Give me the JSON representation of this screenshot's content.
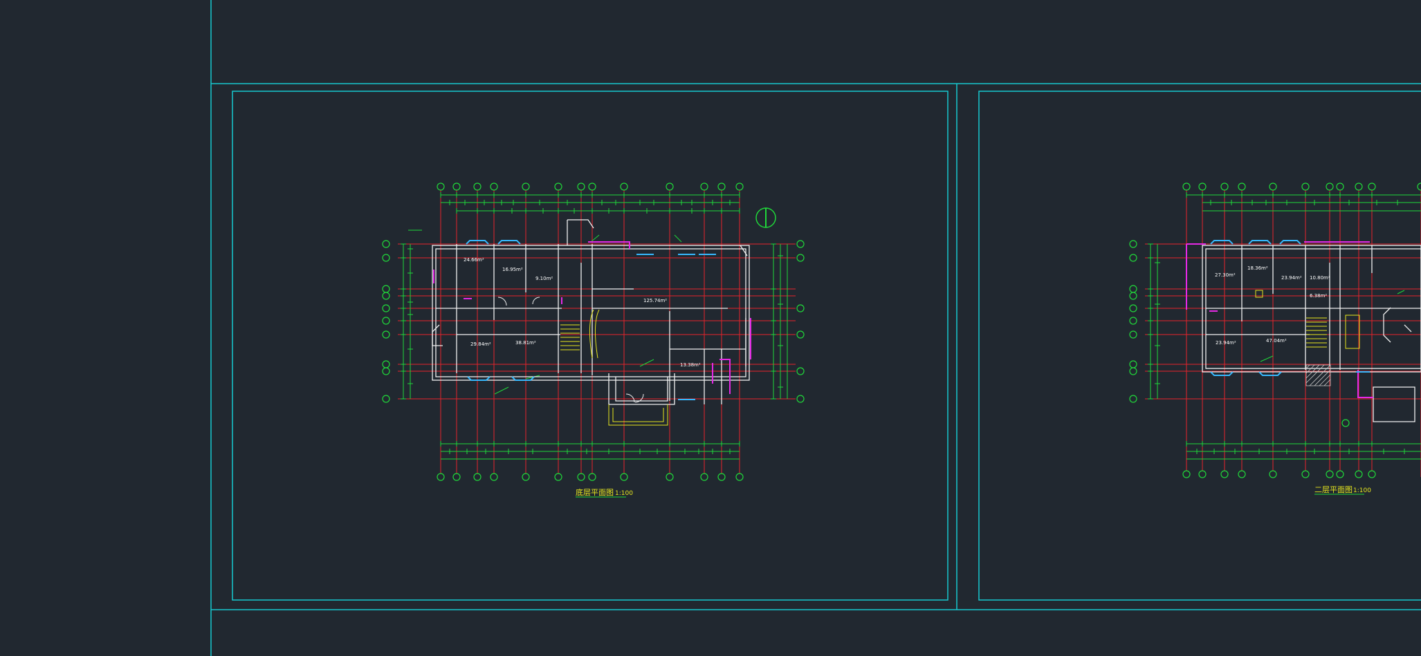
{
  "app": {
    "background": "#212830",
    "colors": {
      "frame": "#17c9cf",
      "grid_axis": "#e8232b",
      "dimension": "#20d83a",
      "wall": "#f2f2f2",
      "accent_wall": "#e629e6",
      "window": "#37b9ff",
      "stair": "#e6e61e",
      "hatch": "#c8c8c8"
    }
  },
  "drawing": {
    "sheet1": {
      "title": "底层平面图",
      "scale": "1:100"
    },
    "sheet2": {
      "title": "二层平面图",
      "scale": "1:100"
    },
    "sheet1_axis_labels_top": [
      "1",
      "2",
      "3",
      "4",
      "5",
      "6",
      "7",
      "8",
      "10",
      "12",
      "13",
      "14",
      "15"
    ],
    "sheet1_axis_labels_side": [
      "N",
      "M",
      "L",
      "K",
      "H",
      "G",
      "F",
      "E",
      "D",
      "C",
      "A"
    ],
    "sheet1_axis_labels_right": [
      "J",
      "I",
      "F",
      "E",
      "B",
      "A"
    ],
    "sheet2_axis_labels_top": [
      "1",
      "2",
      "3",
      "4",
      "5",
      "6",
      "7",
      "8",
      "9",
      "10"
    ],
    "sheet2_axis_labels_side": [
      "N",
      "M",
      "L",
      "K",
      "H",
      "G",
      "F",
      "E",
      "D",
      "C",
      "A"
    ],
    "sheet1_areas": [
      "24.66m²",
      "16.95m²",
      "9.10m²",
      "125.74m²",
      "29.84m²",
      "38.81m²",
      "13.38m²"
    ],
    "sheet2_areas": [
      "27.30m²",
      "18.36m²",
      "23.94m²",
      "10.80m²",
      "6.38m²",
      "23.94m²",
      "47.04m²"
    ]
  }
}
